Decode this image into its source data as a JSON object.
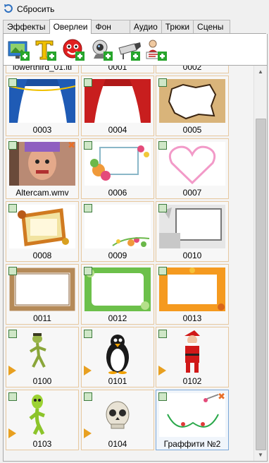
{
  "reset_label": "Сбросить",
  "tabs": [
    {
      "label": "Эффекты"
    },
    {
      "label": "Оверлеи"
    },
    {
      "label": "Фон"
    },
    {
      "label": "Аудио"
    },
    {
      "label": "Трюки"
    },
    {
      "label": "Сцены"
    }
  ],
  "active_tab": "Оверлеи",
  "toolbar": [
    {
      "icon": "add-image-icon"
    },
    {
      "icon": "add-text-icon"
    },
    {
      "icon": "add-smiley-icon"
    },
    {
      "icon": "add-webcam-icon"
    },
    {
      "icon": "add-camera-icon"
    },
    {
      "icon": "add-lower-third-icon"
    }
  ],
  "items": [
    {
      "caption": "lowerthird_01.lti",
      "kind": "lowerthird",
      "checkbox": false
    },
    {
      "caption": "0001",
      "kind": "partial-green",
      "checkbox": false
    },
    {
      "caption": "0002",
      "kind": "partial-green",
      "checkbox": false
    },
    {
      "caption": "0003",
      "kind": "curtain-blue",
      "checkbox": true
    },
    {
      "caption": "0004",
      "kind": "curtain-red",
      "checkbox": true
    },
    {
      "caption": "0005",
      "kind": "burnt-paper",
      "checkbox": true
    },
    {
      "caption": "Altercam.wmv",
      "kind": "video-face",
      "checkbox": true,
      "delete": true
    },
    {
      "caption": "0006",
      "kind": "flower-frame",
      "checkbox": true
    },
    {
      "caption": "0007",
      "kind": "heart",
      "checkbox": true
    },
    {
      "caption": "0008",
      "kind": "autumn-wreath",
      "checkbox": true
    },
    {
      "caption": "0009",
      "kind": "floral-corner",
      "checkbox": true
    },
    {
      "caption": "0010",
      "kind": "grunge-frame",
      "checkbox": true
    },
    {
      "caption": "0011",
      "kind": "wood-frame",
      "checkbox": true
    },
    {
      "caption": "0012",
      "kind": "green-frame",
      "checkbox": true
    },
    {
      "caption": "0013",
      "kind": "leaf-frame",
      "checkbox": true
    },
    {
      "caption": "0100",
      "kind": "frog",
      "checkbox": true,
      "play": true
    },
    {
      "caption": "0101",
      "kind": "penguin",
      "checkbox": true,
      "play": true
    },
    {
      "caption": "0102",
      "kind": "santa",
      "checkbox": true,
      "play": true
    },
    {
      "caption": "0103",
      "kind": "alien",
      "checkbox": true,
      "play": true
    },
    {
      "caption": "0104",
      "kind": "skull",
      "checkbox": true,
      "play": true
    },
    {
      "caption": "Граффити №2",
      "kind": "graffiti",
      "checkbox": true,
      "delete": true,
      "selected": true
    }
  ]
}
